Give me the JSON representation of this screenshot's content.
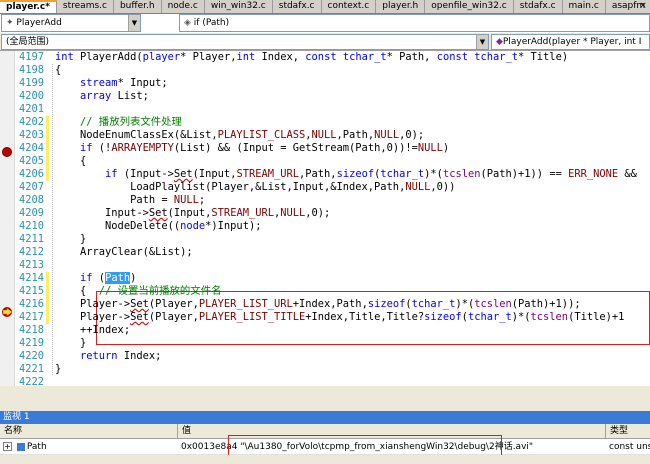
{
  "tabs": [
    {
      "label": "player.c*",
      "active": true
    },
    {
      "label": "streams.c"
    },
    {
      "label": "buffer.h"
    },
    {
      "label": "node.c"
    },
    {
      "label": "win_win32.c"
    },
    {
      "label": "stdafx.c"
    },
    {
      "label": "context.c"
    },
    {
      "label": "player.h"
    },
    {
      "label": "openfile_win32.c"
    },
    {
      "label": "stdafx.c"
    },
    {
      "label": "main.c"
    },
    {
      "label": "asapfm"
    }
  ],
  "tab_close": "×",
  "nav": {
    "scope_combo": "PlayerAdd",
    "member_combo": "if (Path)",
    "global_scope": "(全局范围)",
    "function_combo": "PlayerAdd(player * Player, int I"
  },
  "code_lines": [
    {
      "n": "4197",
      "t": "int PlayerAdd(player* Player,int Index, const tchar_t* Path, const tchar_t* Title)"
    },
    {
      "n": "4198",
      "t": "{"
    },
    {
      "n": "4199",
      "t": "    stream* Input;"
    },
    {
      "n": "4200",
      "t": "    array List;"
    },
    {
      "n": "4201",
      "t": ""
    },
    {
      "n": "4202",
      "t": "    // 播放列表文件处理"
    },
    {
      "n": "4203",
      "t": "    NodeEnumClassEx(&List,PLAYLIST_CLASS,NULL,Path,NULL,0);"
    },
    {
      "n": "4204",
      "t": "    if (!ARRAYEMPTY(List) && (Input = GetStream(Path,0))!=NULL)"
    },
    {
      "n": "4205",
      "t": "    {"
    },
    {
      "n": "4206",
      "t": "        if (Input->Set(Input,STREAM_URL,Path,sizeof(tchar_t)*(tcslen(Path)+1)) == ERR_NONE &&"
    },
    {
      "n": "4207",
      "t": "            LoadPlaylist(Player,&List,Input,&Index,Path,NULL,0))"
    },
    {
      "n": "4208",
      "t": "            Path = NULL;"
    },
    {
      "n": "4209",
      "t": "        Input->Set(Input,STREAM_URL,NULL,0);"
    },
    {
      "n": "4210",
      "t": "        NodeDelete((node*)Input);"
    },
    {
      "n": "4211",
      "t": "    }"
    },
    {
      "n": "4212",
      "t": "    ArrayClear(&List);"
    },
    {
      "n": "4213",
      "t": ""
    },
    {
      "n": "4214",
      "t": "    if (Path)"
    },
    {
      "n": "4215",
      "t": "    {  // 设置当前播放的文件名"
    },
    {
      "n": "4216",
      "t": "    Player->Set(Player,PLAYER_LIST_URL+Index,Path,sizeof(tchar_t)*(tcslen(Path)+1));"
    },
    {
      "n": "4217",
      "t": "    Player->Set(Player,PLAYER_LIST_TITLE+Index,Title,Title?sizeof(tchar_t)*(tcslen(Title)+1"
    },
    {
      "n": "4218",
      "t": "    ++Index;"
    },
    {
      "n": "4219",
      "t": "    }"
    },
    {
      "n": "4220",
      "t": "    return Index;"
    },
    {
      "n": "4221",
      "t": "}"
    },
    {
      "n": "4222",
      "t": ""
    }
  ],
  "watch": {
    "title": "监视 1",
    "col_name": "名称",
    "col_value": "值",
    "col_type": "类型",
    "expand": "+",
    "name": "Path",
    "value_addr": "0x0013e8a4",
    "value_str": "\"\\Au1380_forVolo\\tcpmp_from_xianshengWin32\\debug\\2神话.avi\"",
    "type": "const uns"
  },
  "colors": {
    "keyword": "#0000ff",
    "macro": "#800000",
    "comment": "#008000",
    "linenum": "#2b91af",
    "highlight": "#e81818",
    "watch_title": "#3b7bd8"
  }
}
